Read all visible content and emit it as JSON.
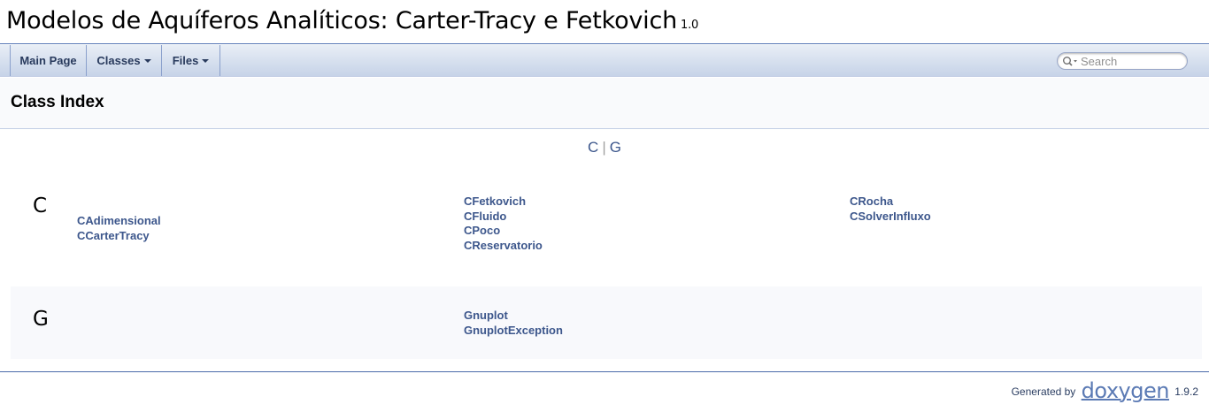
{
  "project": {
    "name": "Modelos de Aquíferos Analíticos: Carter-Tracy e Fetkovich",
    "number": "1.0"
  },
  "nav": {
    "main_page": "Main Page",
    "classes": "Classes",
    "files": "Files"
  },
  "search": {
    "placeholder": "Search"
  },
  "header": {
    "title": "Class Index"
  },
  "qindex": {
    "letters": [
      "C",
      "G"
    ],
    "separator": "|"
  },
  "sections": [
    {
      "letter": "C",
      "columns": [
        [
          "CAdimensional",
          "CCarterTracy"
        ],
        [
          "CFetkovich",
          "CFluido",
          "CPoco",
          "CReservatorio"
        ],
        [
          "CRocha",
          "CSolverInfluxo"
        ]
      ]
    },
    {
      "letter": "G",
      "columns": [
        [],
        [
          "Gnuplot",
          "GnuplotException"
        ],
        []
      ]
    }
  ],
  "footer": {
    "generated_by": "Generated by",
    "logo_text": "doxygen",
    "version": "1.9.2"
  },
  "colors": {
    "link": "#3D578C",
    "nav_text": "#283A5D",
    "border": "#5373B4"
  }
}
